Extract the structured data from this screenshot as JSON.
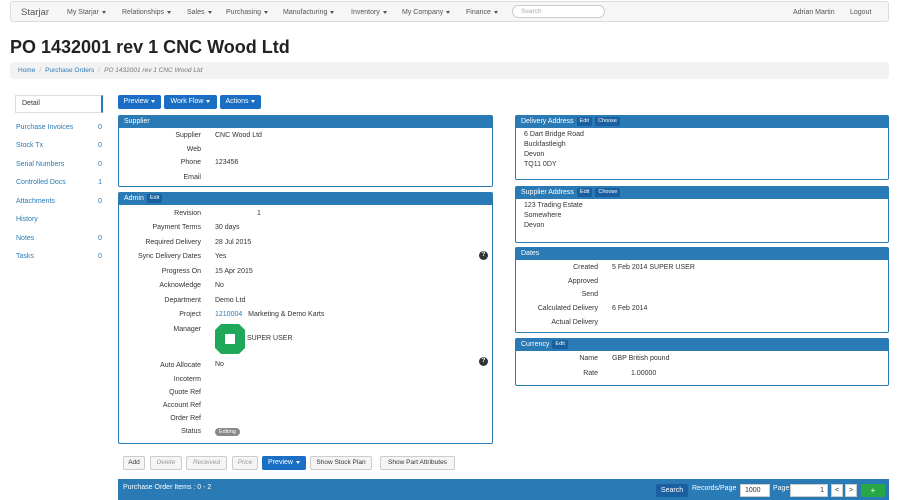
{
  "navbar": {
    "brand": "Starjar",
    "menus": [
      "My Starjar",
      "Relationships",
      "Sales",
      "Purchasing",
      "Manufacturing",
      "Inventory",
      "My Company",
      "Finance"
    ],
    "search_placeholder": "Search",
    "user": "Adrian Martin",
    "logout": "Logout"
  },
  "page": {
    "title": "PO 1432001 rev 1 CNC Wood Ltd",
    "breadcrumb": [
      "Home",
      "Purchase Orders",
      "PO 1432001 rev 1 CNC Wood Ltd"
    ]
  },
  "sidebar": {
    "detail": "Detail",
    "items": [
      {
        "label": "Purchase Invoices",
        "count": "0"
      },
      {
        "label": "Stock Tx",
        "count": "0"
      },
      {
        "label": "Serial Numbers",
        "count": "0"
      },
      {
        "label": "Controlled Docs",
        "count": "1"
      },
      {
        "label": "Attachments",
        "count": "0"
      },
      {
        "label": "History",
        "count": ""
      },
      {
        "label": "Notes",
        "count": "0"
      },
      {
        "label": "Tasks",
        "count": "0"
      }
    ]
  },
  "toolbar": {
    "preview": "Preview",
    "workflow": "Work Flow",
    "actions": "Actions"
  },
  "supplier": {
    "heading": "Supplier",
    "labels": {
      "supplier": "Supplier",
      "web": "Web",
      "phone": "Phone",
      "email": "Email"
    },
    "name": "CNC Wood Ltd",
    "web": "",
    "phone": "123456",
    "email": ""
  },
  "admin": {
    "heading": "Admin",
    "edit": "Edit",
    "labels": {
      "revision": "Revision",
      "payment_terms": "Payment Terms",
      "required_delivery": "Required Delivery",
      "sync_delivery": "Sync Delivery Dates",
      "progress_on": "Progress On",
      "acknowledge": "Acknowledge",
      "department": "Department",
      "project": "Project",
      "manager": "Manager",
      "auto_allocate": "Auto Allocate",
      "incoterm": "Incoterm",
      "quote_ref": "Quote Ref",
      "account_ref": "Account Ref",
      "order_ref": "Order Ref",
      "status": "Status"
    },
    "revision": "1",
    "payment_terms": "30 days",
    "required_delivery": "28 Jul 2015",
    "sync_delivery": "Yes",
    "progress_on": "15 Apr 2015",
    "acknowledge": "No",
    "department": "Demo Ltd",
    "project_code": "1210004",
    "project_name": "Marketing & Demo Karts",
    "manager": "SUPER USER",
    "auto_allocate": "No",
    "status": "Editing",
    "help": "?"
  },
  "delivery_address": {
    "heading": "Delivery Address",
    "edit": "Edit",
    "choose": "Choose",
    "lines": [
      "6 Dart Bridge Road",
      "Buckfastleigh",
      "Devon",
      "TQ11 0DY"
    ]
  },
  "supplier_address": {
    "heading": "Supplier Address",
    "edit": "Edit",
    "choose": "Choose",
    "lines": [
      "123 Trading Estate",
      "Somewhere",
      "Devon"
    ]
  },
  "dates": {
    "heading": "Dates",
    "labels": {
      "created": "Created",
      "approved": "Approved",
      "send": "Send",
      "calculated": "Calculated Delivery",
      "actual": "Actual Delivery"
    },
    "created": "5 Feb 2014 SUPER USER",
    "approved": "",
    "send": "",
    "calculated": "6 Feb 2014",
    "actual": ""
  },
  "currency": {
    "heading": "Currency",
    "edit": "Edit",
    "labels": {
      "name": "Name",
      "rate": "Rate"
    },
    "name": "GBP British pound",
    "rate": "1.00000"
  },
  "items_toolbar": {
    "add": "Add",
    "delete": "Delete",
    "received": "Received",
    "price": "Price",
    "preview": "Preview",
    "stock_plan": "Show Stock Plan",
    "part_attributes": "Show Part Attributes"
  },
  "items_bar": {
    "title": "Purchase Order Items : 0 - 2",
    "search": "Search",
    "records_label": "Records/Page",
    "records_value": "1000",
    "page_label": "Page",
    "page_value": "1",
    "prev": "<",
    "next": ">",
    "add": "+"
  },
  "colors": {
    "accent": "#2a7ab5",
    "button": "#1a6fc4",
    "avatar": "#1fa85a"
  }
}
